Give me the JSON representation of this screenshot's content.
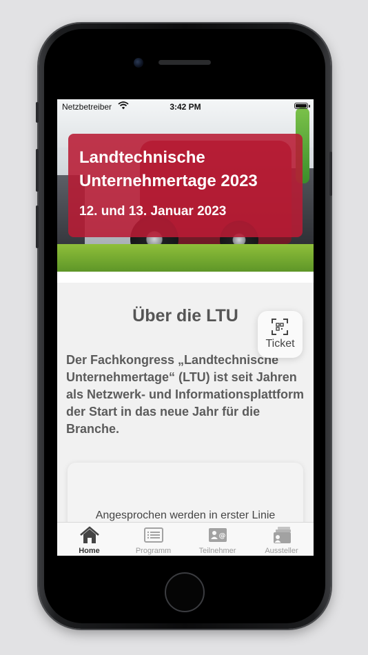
{
  "status_bar": {
    "carrier": "Netzbetreiber",
    "time": "3:42 PM"
  },
  "hero": {
    "title_line1": "Landtechnische",
    "title_line2": "Unternehmertage 2023",
    "date": "12. und 13. Januar 2023"
  },
  "about": {
    "title": "Über die LTU",
    "text": "Der Fachkongress „Landtechnische Unternehmertage“ (LTU) ist seit Jahren als Netzwerk- und Informationsplattform der Start in das neue Jahr für die Branche."
  },
  "card": {
    "text": "Angesprochen werden in erster Linie"
  },
  "ticket_button": {
    "label": "Ticket",
    "icon": "qr-scan-icon"
  },
  "tabs": [
    {
      "label": "Home",
      "icon": "home-icon",
      "active": true
    },
    {
      "label": "Programm",
      "icon": "list-icon",
      "active": false
    },
    {
      "label": "Teilnehmer",
      "icon": "contact-card-icon",
      "active": false
    },
    {
      "label": "Aussteller",
      "icon": "exhibitor-icon",
      "active": false
    }
  ],
  "colors": {
    "banner": "#b81b34",
    "tab_active": "#333333",
    "tab_inactive": "#9b9b9b"
  }
}
